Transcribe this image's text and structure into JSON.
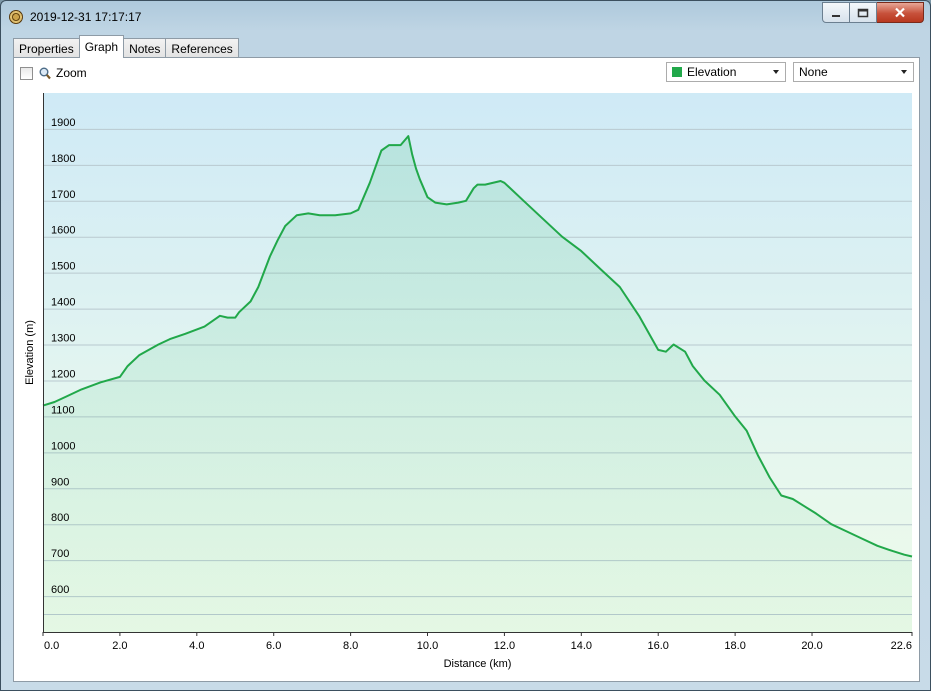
{
  "window": {
    "title": "2019-12-31 17:17:17"
  },
  "tabs": [
    {
      "label": "Properties",
      "active": false
    },
    {
      "label": "Graph",
      "active": true
    },
    {
      "label": "Notes",
      "active": false
    },
    {
      "label": "References",
      "active": false
    }
  ],
  "toolbar": {
    "zoom_label": "Zoom",
    "zoom_checked": false,
    "primary_select": "Elevation",
    "primary_color": "#21a84a",
    "secondary_select": "None"
  },
  "chart_data": {
    "type": "area",
    "xlabel": "Distance  (km)",
    "ylabel": "Elevation (m)",
    "xlim": [
      0,
      22.6
    ],
    "ylim": [
      500,
      2000
    ],
    "x_ticks": [
      "0.0",
      "2.0",
      "4.0",
      "6.0",
      "8.0",
      "10.0",
      "12.0",
      "14.0",
      "16.0",
      "18.0",
      "20.0",
      "22.6"
    ],
    "y_ticks": [
      "600",
      "700",
      "800",
      "900",
      "1000",
      "1100",
      "1200",
      "1300",
      "1400",
      "1500",
      "1600",
      "1700",
      "1800",
      "1900"
    ],
    "grid": true,
    "series": [
      {
        "color": "#21a84a",
        "x": [
          0,
          0.3,
          0.6,
          1.0,
          1.5,
          2.0,
          2.2,
          2.5,
          3.0,
          3.3,
          3.7,
          4.2,
          4.6,
          4.8,
          5.0,
          5.1,
          5.4,
          5.6,
          5.9,
          6.1,
          6.3,
          6.6,
          6.9,
          7.2,
          7.6,
          8.0,
          8.2,
          8.3,
          8.5,
          8.8,
          9.0,
          9.3,
          9.5,
          9.6,
          9.7,
          9.8,
          10.0,
          10.2,
          10.5,
          10.8,
          11.0,
          11.2,
          11.3,
          11.5,
          11.9,
          12.0,
          12.2,
          12.5,
          13.0,
          13.5,
          14.0,
          14.5,
          15.0,
          15.5,
          16.0,
          16.2,
          16.4,
          16.7,
          16.9,
          17.2,
          17.6,
          18.0,
          18.3,
          18.6,
          18.9,
          19.2,
          19.5,
          19.8,
          20.1,
          20.5,
          20.9,
          21.3,
          21.7,
          22.1,
          22.4,
          22.6
        ],
        "y": [
          1130,
          1140,
          1155,
          1175,
          1195,
          1210,
          1240,
          1270,
          1300,
          1315,
          1330,
          1350,
          1380,
          1375,
          1375,
          1390,
          1420,
          1460,
          1545,
          1590,
          1630,
          1660,
          1665,
          1660,
          1660,
          1665,
          1675,
          1700,
          1750,
          1840,
          1855,
          1855,
          1880,
          1830,
          1790,
          1760,
          1710,
          1695,
          1690,
          1695,
          1700,
          1735,
          1745,
          1745,
          1755,
          1750,
          1730,
          1700,
          1650,
          1600,
          1560,
          1510,
          1460,
          1380,
          1285,
          1280,
          1300,
          1280,
          1240,
          1200,
          1160,
          1100,
          1060,
          990,
          930,
          880,
          870,
          850,
          830,
          800,
          780,
          760,
          740,
          725,
          715,
          710
        ]
      }
    ]
  }
}
